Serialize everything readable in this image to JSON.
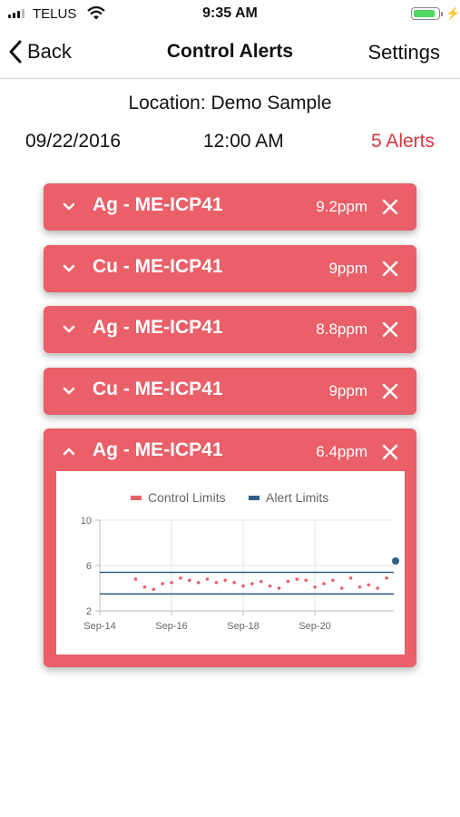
{
  "status_bar": {
    "carrier": "TELUS",
    "time": "9:35 AM",
    "battery_level": 0.9
  },
  "nav": {
    "back_label": "Back",
    "title": "Control Alerts",
    "settings_label": "Settings"
  },
  "summary": {
    "location": "Location: Demo Sample",
    "date": "09/22/2016",
    "time": "12:00 AM",
    "alert_count": "5 Alerts"
  },
  "colors": {
    "alert_card": "#ea5f68",
    "alert_count": "#d9363e",
    "control_limits": "#ea5f68",
    "alert_limits": "#2f5f86"
  },
  "alerts": [
    {
      "title": "Ag - ME-ICP41",
      "value": "9.2ppm",
      "expanded": false
    },
    {
      "title": "Cu - ME-ICP41",
      "value": "9ppm",
      "expanded": false
    },
    {
      "title": "Ag - ME-ICP41",
      "value": "8.8ppm",
      "expanded": false
    },
    {
      "title": "Cu - ME-ICP41",
      "value": "9ppm",
      "expanded": false
    },
    {
      "title": "Ag - ME-ICP41",
      "value": "6.4ppm",
      "expanded": true
    }
  ],
  "chart_data": {
    "type": "scatter",
    "legend": [
      "Control Limits",
      "Alert Limits"
    ],
    "legend_position": "top",
    "x_ticks": [
      "Sep-14",
      "Sep-16",
      "Sep-18",
      "Sep-20"
    ],
    "x_range": [
      14,
      22.2
    ],
    "y_ticks": [
      2,
      6,
      10
    ],
    "ylim": [
      2,
      10
    ],
    "alert_limits": [
      3.5,
      5.4
    ],
    "series": [
      {
        "name": "Control Limits",
        "x": [
          15,
          15.25,
          15.5,
          15.75,
          16,
          16.25,
          16.5,
          16.75,
          17,
          17.25,
          17.5,
          17.75,
          18,
          18.25,
          18.5,
          18.75,
          19,
          19.25,
          19.5,
          19.75,
          20,
          20.25,
          20.5,
          20.75,
          21,
          21.25,
          21.5,
          21.75,
          22
        ],
        "y": [
          4.8,
          4.1,
          3.9,
          4.4,
          4.5,
          4.9,
          4.7,
          4.5,
          4.8,
          4.5,
          4.7,
          4.5,
          4.2,
          4.4,
          4.6,
          4.2,
          4.0,
          4.6,
          4.8,
          4.7,
          4.1,
          4.4,
          4.7,
          4.0,
          4.9,
          4.1,
          4.3,
          4.0,
          4.9
        ]
      }
    ],
    "last_point": {
      "x": 22.2,
      "y": 6.4
    }
  }
}
